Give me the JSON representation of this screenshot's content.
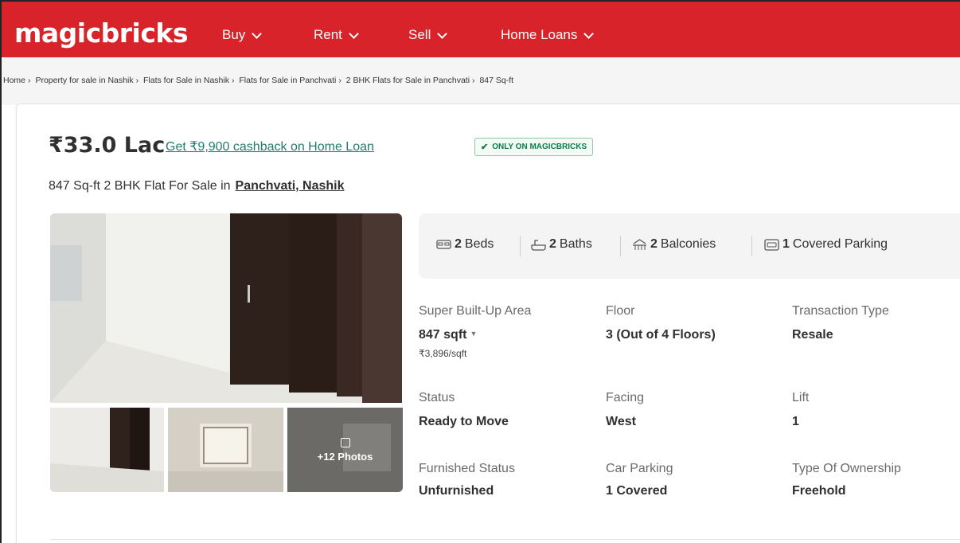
{
  "header": {
    "logo": "magicbricks",
    "nav": [
      "Buy",
      "Rent",
      "Sell",
      "Home Loans"
    ],
    "brand_color": "#d8232a"
  },
  "breadcrumb": [
    "Home",
    "Property for sale in Nashik",
    "Flats for Sale in Nashik",
    "Flats for Sale in Panchvati",
    "2 BHK Flats for Sale in Panchvati",
    "847 Sq-ft"
  ],
  "listing": {
    "price": "₹33.0 Lac",
    "cashback": "Get ₹9,900 cashback on Home Loan",
    "badge": "ONLY ON MAGICBRICKS",
    "subtitle": "847 Sq-ft 2 BHK Flat For Sale in",
    "locality": "Panchvati, Nashik",
    "photos_label": "+12 Photos"
  },
  "amenities": [
    {
      "icon": "bed-icon",
      "count": "2",
      "label": "Beds"
    },
    {
      "icon": "bathtub-icon",
      "count": "2",
      "label": "Baths"
    },
    {
      "icon": "balcony-icon",
      "count": "2",
      "label": "Balconies"
    },
    {
      "icon": "car-icon",
      "count": "1",
      "label": "Covered Parking"
    }
  ],
  "details": {
    "super_area": {
      "label": "Super Built-Up Area",
      "value": "847 sqft",
      "sub": "₹3,896/sqft"
    },
    "floor": {
      "label": "Floor",
      "value": "3 (Out of 4 Floors)"
    },
    "transaction": {
      "label": "Transaction Type",
      "value": "Resale"
    },
    "status": {
      "label": "Status",
      "value": "Ready to Move"
    },
    "facing": {
      "label": "Facing",
      "value": "West"
    },
    "lift": {
      "label": "Lift",
      "value": "1"
    },
    "furnished": {
      "label": "Furnished Status",
      "value": "Unfurnished"
    },
    "car_parking": {
      "label": "Car Parking",
      "value": "1 Covered"
    },
    "ownership": {
      "label": "Type Of Ownership",
      "value": "Freehold"
    }
  }
}
